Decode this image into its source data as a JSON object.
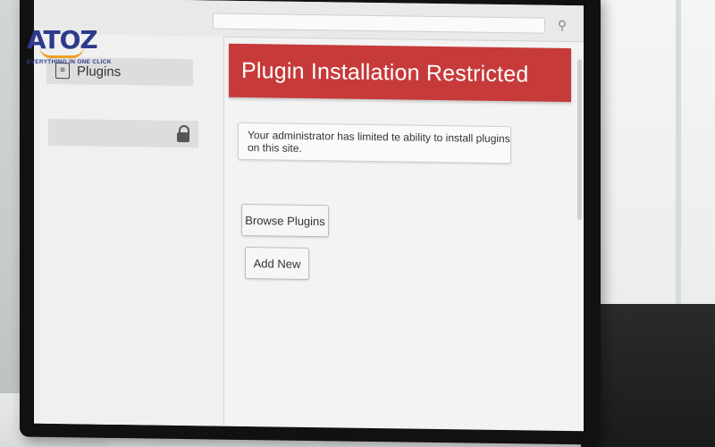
{
  "logo": {
    "brand": "ATOZ",
    "tagline": "EVERYTHING IN ONE CLICK"
  },
  "sidebar": {
    "items": [
      {
        "label": "Plugins",
        "icon": "plugin-icon"
      },
      {
        "label": "",
        "icon": "lock-icon"
      }
    ]
  },
  "main": {
    "banner_title": "Plugin Installation Restricted",
    "notice": "Your administrator has limited te ability to install plugins on this site.",
    "buttons": {
      "browse": "Browse Plugins",
      "add": "Add New"
    }
  },
  "colors": {
    "banner": "#c73a3a",
    "logo_blue": "#2d3a8c",
    "logo_orange": "#f0a020"
  }
}
